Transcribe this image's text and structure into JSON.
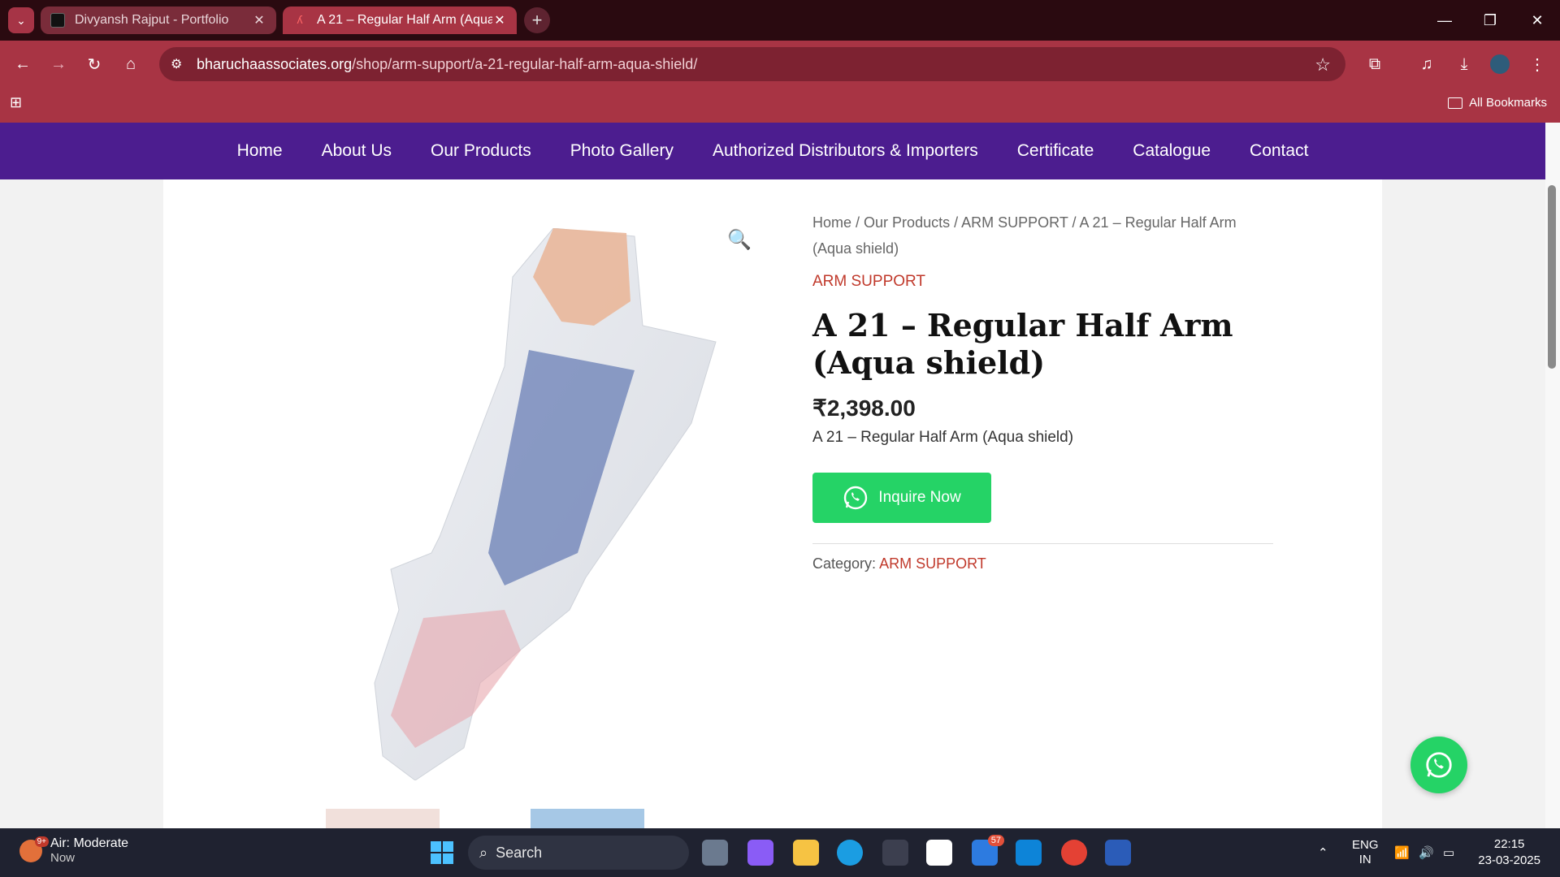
{
  "browser": {
    "tabs": [
      {
        "title": "Divyansh Rajput - Portfolio",
        "active": false
      },
      {
        "title": "A 21 – Regular Half Arm (Aqua",
        "active": true
      }
    ],
    "url_host": "bharuchaassociates.org",
    "url_path": "/shop/arm-support/a-21-regular-half-arm-aqua-shield/",
    "all_bookmarks": "All Bookmarks",
    "colors": {
      "frame": "#2a0a10",
      "toolbar": "#a83444"
    }
  },
  "site_nav": {
    "items": [
      "Home",
      "About Us",
      "Our Products",
      "Photo Gallery",
      "Authorized Distributors & Importers",
      "Certificate",
      "Catalogue",
      "Contact"
    ],
    "color": "#4c1d8f"
  },
  "breadcrumb": {
    "items": [
      "Home",
      "Our Products",
      "ARM SUPPORT",
      "A 21 – Regular Half Arm (Aqua shield)"
    ]
  },
  "product": {
    "category_label": "ARM SUPPORT",
    "title": "A 21 – Regular Half Arm (Aqua shield)",
    "price": "₹2,398.00",
    "short_description": "A 21 – Regular Half Arm (Aqua shield)",
    "inquire_label": "Inquire Now",
    "category_prefix": "Category:",
    "category_value": "ARM SUPPORT"
  },
  "taskbar": {
    "weather_title": "Air: Moderate",
    "weather_sub": "Now",
    "weather_badge": "9+",
    "search_label": "Search",
    "mail_badge": "57",
    "lang_top": "ENG",
    "lang_bottom": "IN",
    "time": "22:15",
    "date": "23-03-2025"
  }
}
